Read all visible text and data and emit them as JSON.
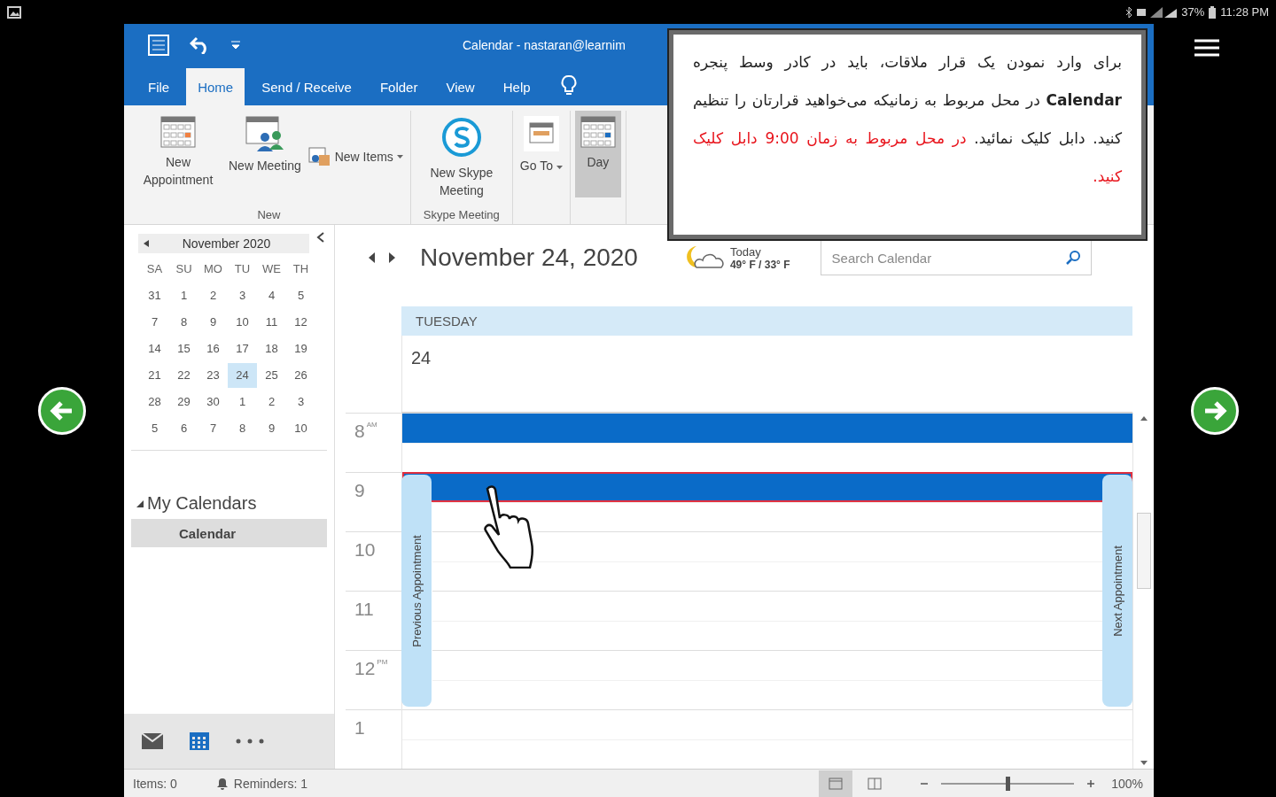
{
  "device": {
    "battery": "37%",
    "clock": "11:28 PM"
  },
  "window": {
    "title": "Calendar - nastaran@learnim"
  },
  "tabs": [
    {
      "label": "File",
      "selected": false
    },
    {
      "label": "Home",
      "selected": true
    },
    {
      "label": "Send / Receive",
      "selected": false
    },
    {
      "label": "Folder",
      "selected": false
    },
    {
      "label": "View",
      "selected": false
    },
    {
      "label": "Help",
      "selected": false
    }
  ],
  "ribbon": {
    "groups": [
      {
        "label": "New",
        "buttons": [
          {
            "kind": "large",
            "label": "New Appointment",
            "dropdown": false,
            "selected": false
          },
          {
            "kind": "large",
            "label": "New Meeting",
            "dropdown": false,
            "selected": false
          },
          {
            "kind": "small",
            "label": "New Items",
            "dropdown": true,
            "selected": false
          }
        ]
      },
      {
        "label": "Skype Meeting",
        "buttons": [
          {
            "kind": "large",
            "label": "New Skype Meeting",
            "dropdown": false,
            "selected": false
          }
        ]
      },
      {
        "buttons": [
          {
            "kind": "large",
            "label": "Go To",
            "dropdown": true,
            "selected": false
          }
        ]
      },
      {
        "buttons": [
          {
            "kind": "large",
            "label": "Day",
            "dropdown": false,
            "selected": true
          }
        ]
      }
    ]
  },
  "mini_calendar": {
    "month": "November 2020",
    "weekdays": [
      "SA",
      "SU",
      "MO",
      "TU",
      "WE",
      "TH"
    ],
    "weeks": [
      [
        {
          "d": "31",
          "selected": false
        },
        {
          "d": "1",
          "selected": false
        },
        {
          "d": "2",
          "selected": false
        },
        {
          "d": "3",
          "selected": false
        },
        {
          "d": "4",
          "selected": false
        },
        {
          "d": "5",
          "selected": false
        }
      ],
      [
        {
          "d": "7",
          "selected": false
        },
        {
          "d": "8",
          "selected": false
        },
        {
          "d": "9",
          "selected": false
        },
        {
          "d": "10",
          "selected": false
        },
        {
          "d": "11",
          "selected": false
        },
        {
          "d": "12",
          "selected": false
        }
      ],
      [
        {
          "d": "14",
          "selected": false
        },
        {
          "d": "15",
          "selected": false
        },
        {
          "d": "16",
          "selected": false
        },
        {
          "d": "17",
          "selected": false
        },
        {
          "d": "18",
          "selected": false
        },
        {
          "d": "19",
          "selected": false
        }
      ],
      [
        {
          "d": "21",
          "selected": false
        },
        {
          "d": "22",
          "selected": false
        },
        {
          "d": "23",
          "selected": false
        },
        {
          "d": "24",
          "selected": true
        },
        {
          "d": "25",
          "selected": false
        },
        {
          "d": "26",
          "selected": false
        }
      ],
      [
        {
          "d": "28",
          "selected": false
        },
        {
          "d": "29",
          "selected": false
        },
        {
          "d": "30",
          "selected": false
        },
        {
          "d": "1",
          "selected": false
        },
        {
          "d": "2",
          "selected": false
        },
        {
          "d": "3",
          "selected": false
        }
      ],
      [
        {
          "d": "5",
          "selected": false
        },
        {
          "d": "6",
          "selected": false
        },
        {
          "d": "7",
          "selected": false
        },
        {
          "d": "8",
          "selected": false
        },
        {
          "d": "9",
          "selected": false
        },
        {
          "d": "10",
          "selected": false
        }
      ]
    ]
  },
  "my_calendars": {
    "label": "My Calendars",
    "expanded": true,
    "items": [
      {
        "label": "Calendar",
        "selected": true
      }
    ]
  },
  "nav": [
    {
      "selected": false
    },
    {
      "selected": true
    },
    {
      "selected": false
    }
  ],
  "day_view": {
    "date": "November 24, 2020",
    "weather": {
      "label": "Today",
      "temps": "49° F / 33° F"
    },
    "search": {
      "placeholder": "Search Calendar"
    },
    "weekday": "TUESDAY",
    "day": "24",
    "hours": [
      {
        "label": "8",
        "suffix": "AM",
        "slots": [
          {
            "kind": "filled",
            "selected": false
          },
          {
            "kind": "empty",
            "selected": false
          }
        ]
      },
      {
        "label": "9",
        "slots": [
          {
            "kind": "filled",
            "selected": true
          },
          {
            "kind": "empty",
            "selected": false
          }
        ]
      },
      {
        "label": "10",
        "slots": [
          {
            "kind": "empty",
            "selected": false
          },
          {
            "kind": "empty",
            "selected": false
          }
        ]
      },
      {
        "label": "11",
        "slots": [
          {
            "kind": "empty",
            "selected": false
          },
          {
            "kind": "empty",
            "selected": false
          }
        ]
      },
      {
        "label": "12",
        "suffix": "PM",
        "slots": [
          {
            "kind": "empty",
            "selected": false
          },
          {
            "kind": "empty",
            "selected": false
          }
        ]
      },
      {
        "label": "1",
        "slots": [
          {
            "kind": "empty",
            "selected": false
          },
          {
            "kind": "empty",
            "selected": false
          }
        ]
      }
    ],
    "previous_label": "Previous Appointment",
    "next_label": "Next Appointment"
  },
  "status_bar": {
    "items": "Items: 0",
    "reminders": "Reminders: 1",
    "views": [
      {
        "selected": true
      },
      {
        "selected": false
      }
    ],
    "level": 0.5,
    "zoom": "100%"
  },
  "note": {
    "segments": [
      {
        "text": "برای وارد نمودن یک قرار ملاقات، باید در کادر وسط پنجره **Calendar** در محل مربوط به زمانیکه می‌خواهید قرارتان را تنظیم کنید. دابل کلیک نمائید. ",
        "highlight": false
      },
      {
        "text": "در محل مربوط به زمان 9:00 دابل کلیک کنید.",
        "highlight": true
      }
    ]
  }
}
